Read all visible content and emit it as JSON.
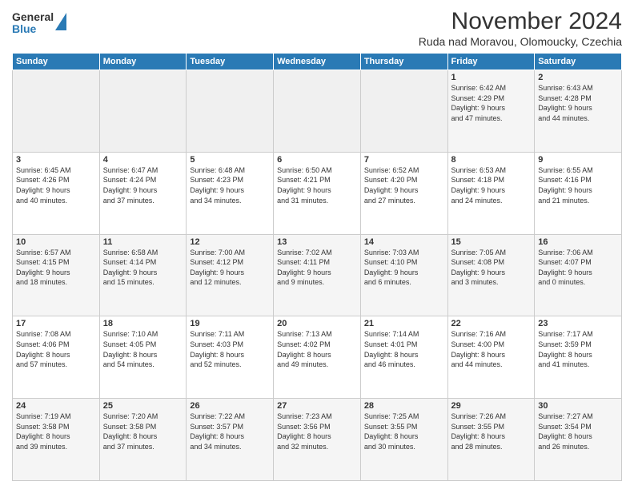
{
  "logo": {
    "general": "General",
    "blue": "Blue"
  },
  "header": {
    "month_title": "November 2024",
    "location": "Ruda nad Moravou, Olomoucky, Czechia"
  },
  "weekdays": [
    "Sunday",
    "Monday",
    "Tuesday",
    "Wednesday",
    "Thursday",
    "Friday",
    "Saturday"
  ],
  "weeks": [
    {
      "days": [
        {
          "num": "",
          "info": ""
        },
        {
          "num": "",
          "info": ""
        },
        {
          "num": "",
          "info": ""
        },
        {
          "num": "",
          "info": ""
        },
        {
          "num": "",
          "info": ""
        },
        {
          "num": "1",
          "info": "Sunrise: 6:42 AM\nSunset: 4:29 PM\nDaylight: 9 hours\nand 47 minutes."
        },
        {
          "num": "2",
          "info": "Sunrise: 6:43 AM\nSunset: 4:28 PM\nDaylight: 9 hours\nand 44 minutes."
        }
      ]
    },
    {
      "days": [
        {
          "num": "3",
          "info": "Sunrise: 6:45 AM\nSunset: 4:26 PM\nDaylight: 9 hours\nand 40 minutes."
        },
        {
          "num": "4",
          "info": "Sunrise: 6:47 AM\nSunset: 4:24 PM\nDaylight: 9 hours\nand 37 minutes."
        },
        {
          "num": "5",
          "info": "Sunrise: 6:48 AM\nSunset: 4:23 PM\nDaylight: 9 hours\nand 34 minutes."
        },
        {
          "num": "6",
          "info": "Sunrise: 6:50 AM\nSunset: 4:21 PM\nDaylight: 9 hours\nand 31 minutes."
        },
        {
          "num": "7",
          "info": "Sunrise: 6:52 AM\nSunset: 4:20 PM\nDaylight: 9 hours\nand 27 minutes."
        },
        {
          "num": "8",
          "info": "Sunrise: 6:53 AM\nSunset: 4:18 PM\nDaylight: 9 hours\nand 24 minutes."
        },
        {
          "num": "9",
          "info": "Sunrise: 6:55 AM\nSunset: 4:16 PM\nDaylight: 9 hours\nand 21 minutes."
        }
      ]
    },
    {
      "days": [
        {
          "num": "10",
          "info": "Sunrise: 6:57 AM\nSunset: 4:15 PM\nDaylight: 9 hours\nand 18 minutes."
        },
        {
          "num": "11",
          "info": "Sunrise: 6:58 AM\nSunset: 4:14 PM\nDaylight: 9 hours\nand 15 minutes."
        },
        {
          "num": "12",
          "info": "Sunrise: 7:00 AM\nSunset: 4:12 PM\nDaylight: 9 hours\nand 12 minutes."
        },
        {
          "num": "13",
          "info": "Sunrise: 7:02 AM\nSunset: 4:11 PM\nDaylight: 9 hours\nand 9 minutes."
        },
        {
          "num": "14",
          "info": "Sunrise: 7:03 AM\nSunset: 4:10 PM\nDaylight: 9 hours\nand 6 minutes."
        },
        {
          "num": "15",
          "info": "Sunrise: 7:05 AM\nSunset: 4:08 PM\nDaylight: 9 hours\nand 3 minutes."
        },
        {
          "num": "16",
          "info": "Sunrise: 7:06 AM\nSunset: 4:07 PM\nDaylight: 9 hours\nand 0 minutes."
        }
      ]
    },
    {
      "days": [
        {
          "num": "17",
          "info": "Sunrise: 7:08 AM\nSunset: 4:06 PM\nDaylight: 8 hours\nand 57 minutes."
        },
        {
          "num": "18",
          "info": "Sunrise: 7:10 AM\nSunset: 4:05 PM\nDaylight: 8 hours\nand 54 minutes."
        },
        {
          "num": "19",
          "info": "Sunrise: 7:11 AM\nSunset: 4:03 PM\nDaylight: 8 hours\nand 52 minutes."
        },
        {
          "num": "20",
          "info": "Sunrise: 7:13 AM\nSunset: 4:02 PM\nDaylight: 8 hours\nand 49 minutes."
        },
        {
          "num": "21",
          "info": "Sunrise: 7:14 AM\nSunset: 4:01 PM\nDaylight: 8 hours\nand 46 minutes."
        },
        {
          "num": "22",
          "info": "Sunrise: 7:16 AM\nSunset: 4:00 PM\nDaylight: 8 hours\nand 44 minutes."
        },
        {
          "num": "23",
          "info": "Sunrise: 7:17 AM\nSunset: 3:59 PM\nDaylight: 8 hours\nand 41 minutes."
        }
      ]
    },
    {
      "days": [
        {
          "num": "24",
          "info": "Sunrise: 7:19 AM\nSunset: 3:58 PM\nDaylight: 8 hours\nand 39 minutes."
        },
        {
          "num": "25",
          "info": "Sunrise: 7:20 AM\nSunset: 3:58 PM\nDaylight: 8 hours\nand 37 minutes."
        },
        {
          "num": "26",
          "info": "Sunrise: 7:22 AM\nSunset: 3:57 PM\nDaylight: 8 hours\nand 34 minutes."
        },
        {
          "num": "27",
          "info": "Sunrise: 7:23 AM\nSunset: 3:56 PM\nDaylight: 8 hours\nand 32 minutes."
        },
        {
          "num": "28",
          "info": "Sunrise: 7:25 AM\nSunset: 3:55 PM\nDaylight: 8 hours\nand 30 minutes."
        },
        {
          "num": "29",
          "info": "Sunrise: 7:26 AM\nSunset: 3:55 PM\nDaylight: 8 hours\nand 28 minutes."
        },
        {
          "num": "30",
          "info": "Sunrise: 7:27 AM\nSunset: 3:54 PM\nDaylight: 8 hours\nand 26 minutes."
        }
      ]
    }
  ]
}
